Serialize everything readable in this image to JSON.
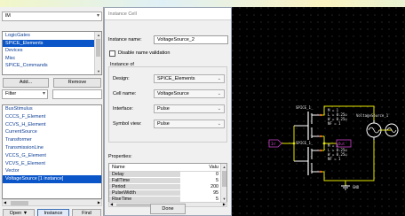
{
  "left_panel": {
    "library_combo": "lM",
    "libraries": [
      {
        "label": "LogicGates",
        "selected": false
      },
      {
        "label": "SPICE_Elements",
        "selected": true
      },
      {
        "label": "Devices",
        "selected": false
      },
      {
        "label": "Misc",
        "selected": false
      },
      {
        "label": "SPICE_Commands",
        "selected": false
      }
    ],
    "add_label": "Add...",
    "remove_label": "Remove",
    "filter_label": "Filter",
    "filter_value": "",
    "elements": [
      {
        "label": "BusStimulus",
        "selected": false
      },
      {
        "label": "CCCS_F_Element",
        "selected": false
      },
      {
        "label": "CCVS_H_Element",
        "selected": false
      },
      {
        "label": "CurrentSource",
        "selected": false
      },
      {
        "label": "Transformer",
        "selected": false
      },
      {
        "label": "TransmissionLine",
        "selected": false
      },
      {
        "label": "VCCS_G_Element",
        "selected": false
      },
      {
        "label": "VCVS_E_Element",
        "selected": false
      },
      {
        "label": "Vector",
        "selected": false
      },
      {
        "label": "VoltageSource [1 instance]",
        "selected": true
      }
    ],
    "open_label": "Open",
    "instance_label": "Instance",
    "find_label": "Find"
  },
  "dialog": {
    "title": "Instance Cell",
    "instance_name_label": "Instance name:",
    "instance_name_value": "VoltageSource_2",
    "disable_validation_label": "Disable name validation",
    "instance_of_label": "Instance of",
    "design_label": "Design:",
    "design_value": "SPICE_Elements",
    "cell_name_label": "Cell name:",
    "cell_name_value": "VoltageSource",
    "interface_label": "Interface:",
    "interface_value": "Pulse",
    "symbol_view_label": "Symbol view:",
    "symbol_view_value": "Pulse",
    "properties_label": "Properties:",
    "props_header_name": "Name",
    "props_header_value": "Valu",
    "properties": [
      {
        "name": "Delay",
        "value": "0"
      },
      {
        "name": "FallTime",
        "value": "5"
      },
      {
        "name": "Period",
        "value": "200"
      },
      {
        "name": "PulseWidth",
        "value": "95"
      },
      {
        "name": "RiseTime",
        "value": "5"
      }
    ],
    "done_label": "Done"
  },
  "canvas": {
    "labels": {
      "inst_top": "SPICE_1_",
      "inst_bottom": "SPICE_1_",
      "params_top_1": "M = 1",
      "params_top_2": "L = 0.25u",
      "params_top_3": "W = 0.25u",
      "params_top_4": "NF = 1",
      "source_name": "VoltageSource_1",
      "params_bot_1": "M = 1",
      "params_bot_2": "L = 0.25u",
      "params_bot_3": "W = 0.25u",
      "params_bot_4": "NF = 1",
      "input_label": "In",
      "out_label": "Out",
      "gnd_label": "GND"
    },
    "colors": {
      "background": "#000000",
      "wire": "#e6e600",
      "component": "#ffffff",
      "pin": "#ff3c3c",
      "net": "#cc44cc",
      "text": "#e8e8e8"
    }
  }
}
